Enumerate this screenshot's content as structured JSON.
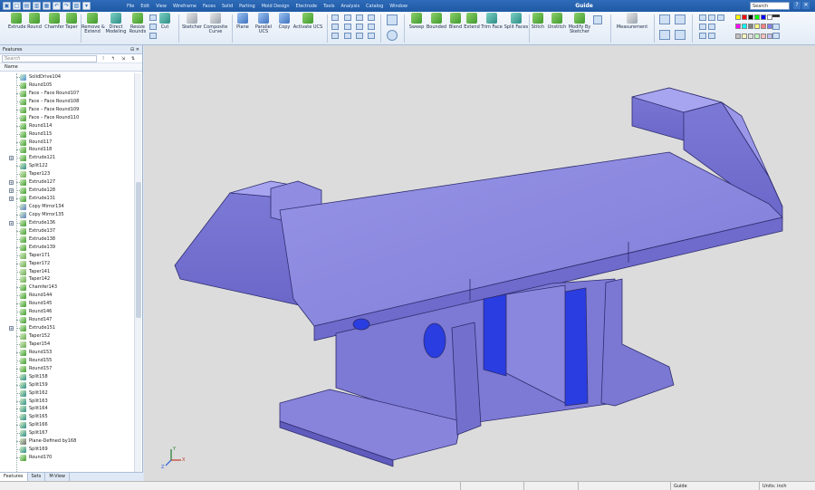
{
  "window": {
    "title": "Guide",
    "search_placeholder": "Search"
  },
  "menu": [
    "File",
    "Edit",
    "View",
    "Wireframe",
    "Faces",
    "Solid",
    "Parting",
    "Mold Design",
    "Electrode",
    "Tools",
    "Analysis",
    "Catalog",
    "Window"
  ],
  "ribbon": {
    "extrude": "Extrude",
    "round": "Round",
    "chamfer": "Chamfer",
    "taper": "Taper",
    "remove_extend": "Remove &\nExtend",
    "direct_modeling": "Direct\nModeling",
    "resize_rounds": "Resize\nRounds",
    "cut": "Cut",
    "sketcher": "Sketcher",
    "composite_curve": "Composite\nCurve",
    "plane": "Plane",
    "parallel_ucs": "Parallel UCS",
    "copy": "Copy",
    "activate_ucs": "Activate UCS",
    "sweep": "Sweep",
    "bounded": "Bounded",
    "blend": "Blend",
    "extend": "Extend",
    "trim_face": "Trim Face",
    "split_faces": "Split Faces",
    "stitch": "Stitch",
    "unstitch": "Unstitch",
    "modify_by_sketcher": "Modify By\nSketcher",
    "measurement": "Measurement"
  },
  "palette_colors": [
    "#ffff00",
    "#ff0000",
    "#000000",
    "#00ff00",
    "#0000ff",
    "#ffffff",
    "#ff00ff",
    "#00ffff",
    "#808080",
    "#ffff80",
    "#ff8080",
    "#8080ff",
    "#c0c0c0",
    "#ffffc0",
    "#e0e0e0",
    "#c0ffc0",
    "#ffc0c0",
    "#c0c0ff"
  ],
  "features_panel": {
    "title": "Features",
    "search_placeholder": "Search",
    "column_name": "Name",
    "tabs": [
      "Features",
      "Sets",
      "M-View"
    ]
  },
  "features": [
    {
      "label": "SolidDrive104",
      "icon": "solid",
      "expand": false
    },
    {
      "label": "Round105",
      "icon": "round",
      "expand": false
    },
    {
      "label": "Face – Face Round107",
      "icon": "round",
      "expand": false
    },
    {
      "label": "Face – Face Round108",
      "icon": "round",
      "expand": false
    },
    {
      "label": "Face – Face Round109",
      "icon": "round",
      "expand": false
    },
    {
      "label": "Face – Face Round110",
      "icon": "round",
      "expand": false
    },
    {
      "label": "Round114",
      "icon": "round",
      "expand": false
    },
    {
      "label": "Round115",
      "icon": "round",
      "expand": false
    },
    {
      "label": "Round117",
      "icon": "round",
      "expand": false
    },
    {
      "label": "Round118",
      "icon": "round",
      "expand": false
    },
    {
      "label": "Extrude121",
      "icon": "extrude",
      "expand": true
    },
    {
      "label": "Split122",
      "icon": "split",
      "expand": false
    },
    {
      "label": "Taper123",
      "icon": "taper",
      "expand": false
    },
    {
      "label": "Extrude127",
      "icon": "extrude",
      "expand": true
    },
    {
      "label": "Extrude128",
      "icon": "extrude",
      "expand": true
    },
    {
      "label": "Extrude131",
      "icon": "extrude",
      "expand": true
    },
    {
      "label": "Copy Mirror134",
      "icon": "copy",
      "expand": false
    },
    {
      "label": "Copy Mirror135",
      "icon": "copy",
      "expand": false
    },
    {
      "label": "Extrude136",
      "icon": "extrude",
      "expand": true
    },
    {
      "label": "Extrude137",
      "icon": "extrude",
      "expand": false
    },
    {
      "label": "Extrude138",
      "icon": "extrude",
      "expand": false
    },
    {
      "label": "Extrude139",
      "icon": "extrude",
      "expand": false
    },
    {
      "label": "Taper171",
      "icon": "taper",
      "expand": false
    },
    {
      "label": "Taper172",
      "icon": "taper",
      "expand": false
    },
    {
      "label": "Taper141",
      "icon": "taper",
      "expand": false
    },
    {
      "label": "Taper142",
      "icon": "taper",
      "expand": false
    },
    {
      "label": "Chamfer143",
      "icon": "chamfer",
      "expand": false
    },
    {
      "label": "Round144",
      "icon": "round",
      "expand": false
    },
    {
      "label": "Round145",
      "icon": "round",
      "expand": false
    },
    {
      "label": "Round146",
      "icon": "round",
      "expand": false
    },
    {
      "label": "Round147",
      "icon": "round",
      "expand": false
    },
    {
      "label": "Extrude151",
      "icon": "extrude",
      "expand": true
    },
    {
      "label": "Taper152",
      "icon": "taper",
      "expand": false
    },
    {
      "label": "Taper154",
      "icon": "taper",
      "expand": false
    },
    {
      "label": "Round153",
      "icon": "round",
      "expand": false
    },
    {
      "label": "Round155",
      "icon": "round",
      "expand": false
    },
    {
      "label": "Round157",
      "icon": "round",
      "expand": false
    },
    {
      "label": "Split158",
      "icon": "split",
      "expand": false
    },
    {
      "label": "Split159",
      "icon": "split",
      "expand": false
    },
    {
      "label": "Split162",
      "icon": "split",
      "expand": false
    },
    {
      "label": "Split163",
      "icon": "split",
      "expand": false
    },
    {
      "label": "Split164",
      "icon": "split",
      "expand": false
    },
    {
      "label": "Split165",
      "icon": "split",
      "expand": false
    },
    {
      "label": "Split166",
      "icon": "split",
      "expand": false
    },
    {
      "label": "Split167",
      "icon": "split",
      "expand": false
    },
    {
      "label": "Plane-Defined by168",
      "icon": "plane",
      "expand": false
    },
    {
      "label": "Split169",
      "icon": "split",
      "expand": false
    },
    {
      "label": "Round170",
      "icon": "round",
      "expand": false
    }
  ],
  "axis": {
    "x": "X",
    "y": "Y",
    "z": "Z"
  },
  "status": {
    "file": "Guide",
    "units": "Units: inch"
  },
  "colors": {
    "part_face": "#8c89e0",
    "part_face_dark": "#6f6bcc",
    "part_face_light": "#a6a3ee",
    "hole_blue": "#2a3de0"
  }
}
